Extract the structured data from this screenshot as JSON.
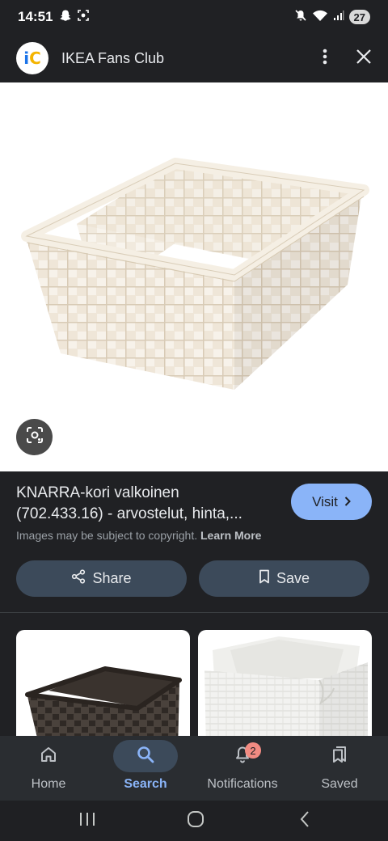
{
  "status_bar": {
    "time": "14:51",
    "battery": "27",
    "icons": [
      "snapchat-icon",
      "screenshot-icon",
      "mute-icon",
      "wifi-icon",
      "signal-icon"
    ]
  },
  "header": {
    "logo_text_i": "i",
    "logo_text_c": "C",
    "site_name": "IKEA Fans Club",
    "icons": [
      "more-vert-icon",
      "close-icon"
    ]
  },
  "result": {
    "title_line1": "KNARRA-kori valkoinen",
    "title_line2": "(702.433.16) - arvostelut, hinta,...",
    "visit_label": "Visit",
    "copyright_text": "Images may be subject to copyright.",
    "learn_more": "Learn More",
    "share_label": "Share",
    "save_label": "Save"
  },
  "bottom_nav": {
    "items": [
      {
        "label": "Home",
        "icon": "home-icon"
      },
      {
        "label": "Search",
        "icon": "search-icon",
        "active": true
      },
      {
        "label": "Notifications",
        "icon": "bell-icon",
        "badge": "2"
      },
      {
        "label": "Saved",
        "icon": "bookmarks-icon"
      }
    ]
  },
  "colors": {
    "background": "#202124",
    "accent": "#8ab4f8",
    "chip": "#3c4a5a",
    "badge": "#f28b82"
  }
}
